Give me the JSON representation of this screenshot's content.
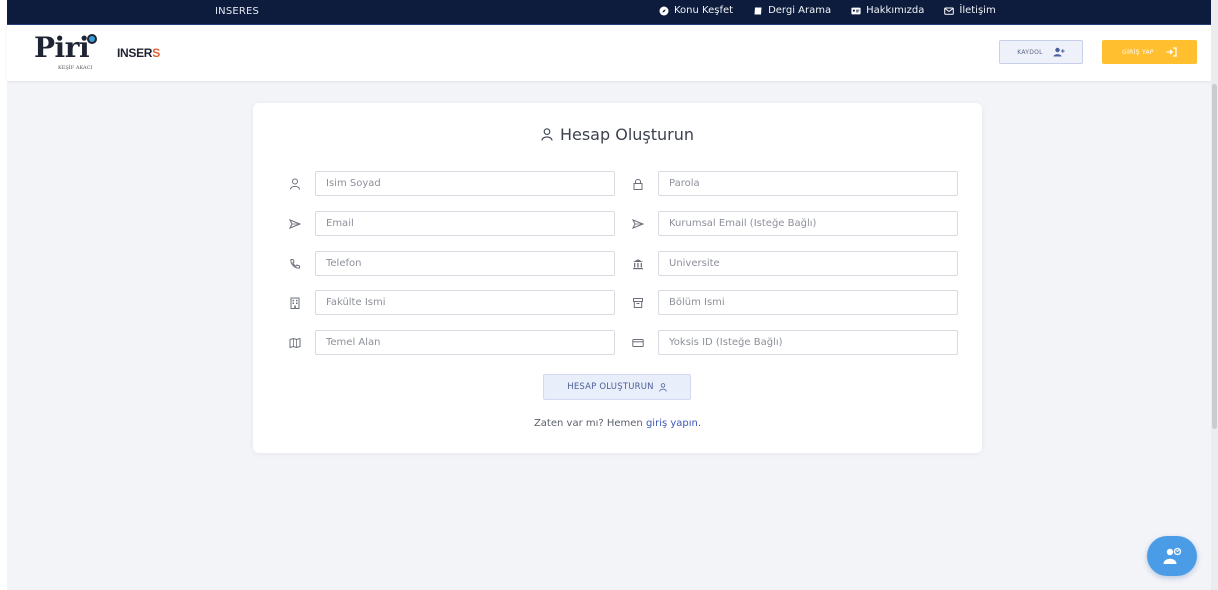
{
  "topbar": {
    "brand": "INSERES",
    "nav": [
      {
        "label": "Konu Keşfet",
        "icon": "compass-icon"
      },
      {
        "label": "Dergi Arama",
        "icon": "journal-icon"
      },
      {
        "label": "Hakkımızda",
        "icon": "id-card-icon"
      },
      {
        "label": "İletişim",
        "icon": "envelope-icon"
      }
    ]
  },
  "header": {
    "logo_piri": "Piri",
    "logo_piri_sub": "KEŞİF AKACI",
    "logo_inser": "INSER",
    "logo_inser_s": "S",
    "signup_label": "KAYDOL",
    "login_label": "GİRİŞ YAP"
  },
  "form": {
    "title": "Hesap Oluşturun",
    "fields": [
      {
        "placeholder": "İsim Soyad",
        "icon": "user-icon"
      },
      {
        "placeholder": "Parola",
        "icon": "lock-icon"
      },
      {
        "placeholder": "Email",
        "icon": "send-icon"
      },
      {
        "placeholder": "Kurumsal Email (İsteğe Bağlı)",
        "icon": "send-icon"
      },
      {
        "placeholder": "Telefon",
        "icon": "phone-icon"
      },
      {
        "placeholder": "Üniversite",
        "icon": "bank-icon"
      },
      {
        "placeholder": "Fakülte İsmi",
        "icon": "building-icon"
      },
      {
        "placeholder": "Bölüm İsmi",
        "icon": "archive-icon"
      },
      {
        "placeholder": "Temel Alan",
        "icon": "map-icon"
      },
      {
        "placeholder": "Yoksis ID (İsteğe Bağlı)",
        "icon": "card-icon"
      }
    ],
    "submit_label": "HESAP OLUŞTURUN",
    "login_prompt": "Zaten var mı? Hemen ",
    "login_link": "giriş yapın."
  },
  "colors": {
    "topbar_bg": "#0d1b3c",
    "login_button": "#ffbf2f",
    "fab": "#4a9ce6",
    "link": "#3e57b6"
  },
  "fab": {
    "icon": "support-agent-icon"
  }
}
